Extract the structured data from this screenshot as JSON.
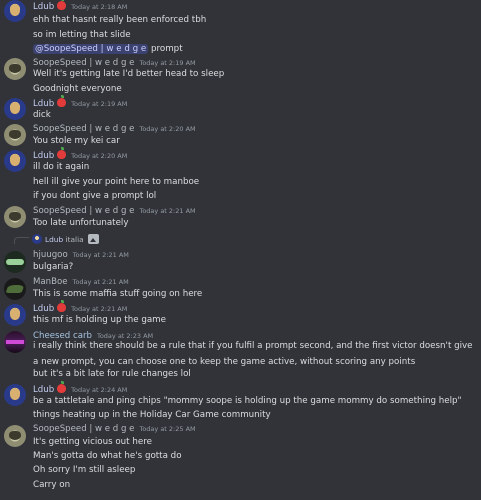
{
  "messages": [
    {
      "author": "Ldub",
      "time": "Today at 2:18 AM",
      "lines": [
        "ehh that hasnt really been enforced tbh",
        "so im letting that slide"
      ],
      "mention": "@SoopeSpeed | w e d g e",
      "mention_after": " prompt"
    },
    {
      "author": "SoopeSpeed | w e d g e",
      "time": "Today at 2:19 AM",
      "lines": [
        "Well it's getting late I'd better head to sleep",
        "Goodnight everyone"
      ]
    },
    {
      "author": "Ldub",
      "time": "Today at 2:19 AM",
      "lines": [
        "dick"
      ]
    },
    {
      "author": "SoopeSpeed | w e d g e",
      "time": "Today at 2:20 AM",
      "lines": [
        "You stole my kei car"
      ]
    },
    {
      "author": "Ldub",
      "time": "Today at 2:20 AM",
      "lines": [
        "ill do it again",
        "hell ill give your point here to manboe",
        "if you dont give a prompt lol"
      ]
    },
    {
      "author": "SoopeSpeed | w e d g e",
      "time": "Today at 2:21 AM",
      "lines": [
        "Too late unfortunately"
      ]
    },
    {
      "reply_author": "Ldub",
      "reply_text": "italia",
      "author": "hjuugoo",
      "time": "Today at 2:21 AM",
      "lines": [
        "bulgaria?"
      ]
    },
    {
      "author": "ManBoe",
      "time": "Today at 2:21 AM",
      "lines": [
        "This is some maffia stuff going on here"
      ]
    },
    {
      "author": "Ldub",
      "time": "Today at 2:21 AM",
      "lines": [
        "this mf is holding up the game"
      ]
    },
    {
      "author": "Cheesed carb",
      "time": "Today at 2:23 AM",
      "lines": [
        "i really think there should be a rule that if you fulfil a prompt second, and the first victor doesn't give a new prompt, you can choose one to keep the game active, without scoring any points",
        "but it's a bit late for rule changes lol"
      ]
    },
    {
      "author": "Ldub",
      "time": "Today at 2:24 AM",
      "lines": [
        "be a tattletale and ping chips \"mommy soope is holding up the game mommy do something help\"",
        "things heating up in the Holiday Car Game community"
      ]
    },
    {
      "author": "SoopeSpeed | w e d g e",
      "time": "Today at 2:25 AM",
      "lines": [
        "It's getting vicious out here",
        "Man's gotta do what he's gotta do",
        "Oh sorry I'm still asleep",
        "Carry on"
      ]
    }
  ]
}
